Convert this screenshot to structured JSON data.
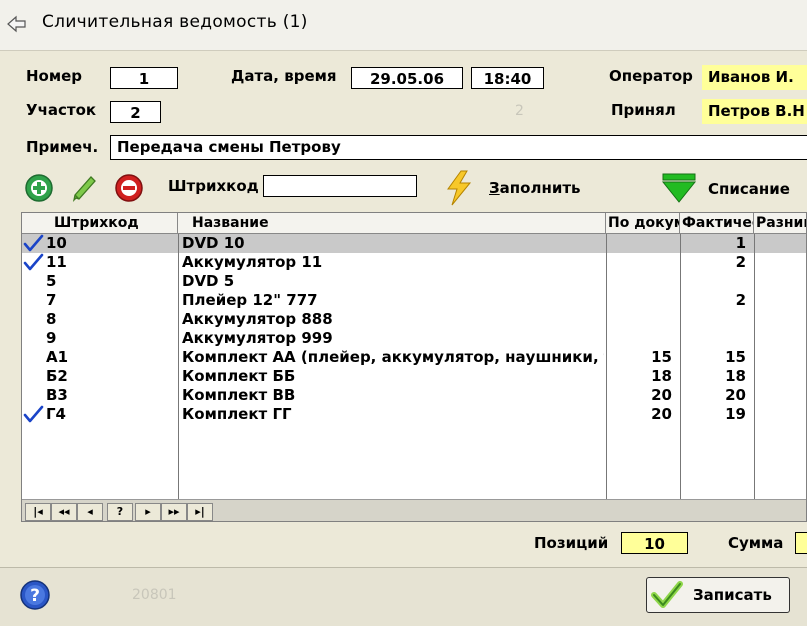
{
  "window": {
    "title": "Сличительная ведомость  (1)"
  },
  "header": {
    "number_label": "Номер",
    "number_value": "1",
    "datetime_label": "Дата, время",
    "date_value": "29.05.06",
    "time_value": "18:40",
    "operator_label": "Оператор",
    "operator_value": "Иванов И.",
    "section_label": "Участок",
    "section_value": "2",
    "ghost_value": "2",
    "accepted_label": "Принял",
    "accepted_value": "Петров В.Н",
    "note_label": "Примеч.",
    "note_value": "Передача смены Петрову"
  },
  "toolbar": {
    "barcode_label": "Штрихкод",
    "barcode_value": "",
    "fill_label_u": "З",
    "fill_label_rest": "аполнить",
    "writeoff_label": "Списание"
  },
  "table": {
    "columns": [
      "Штрихкод",
      "Название",
      "По докум",
      "Фактически",
      "Разница"
    ],
    "rows": [
      {
        "checked": true,
        "barcode": "10",
        "name": "DVD 10",
        "doc": "",
        "fact": "1"
      },
      {
        "checked": true,
        "barcode": "11",
        "name": "Аккумулятор 11",
        "doc": "",
        "fact": "2"
      },
      {
        "checked": false,
        "barcode": "5",
        "name": "DVD 5",
        "doc": "",
        "fact": ""
      },
      {
        "checked": false,
        "barcode": "7",
        "name": "Плейер 12\" 777",
        "doc": "",
        "fact": "2"
      },
      {
        "checked": false,
        "barcode": "8",
        "name": "Аккумулятор 888",
        "doc": "",
        "fact": ""
      },
      {
        "checked": false,
        "barcode": "9",
        "name": "Аккумулятор 999",
        "doc": "",
        "fact": ""
      },
      {
        "checked": false,
        "barcode": "А1",
        "name": "Комплект АА (плейер, аккумулятор, наушники, т",
        "doc": "15",
        "fact": "15"
      },
      {
        "checked": false,
        "barcode": "Б2",
        "name": "Комплект ББ",
        "doc": "18",
        "fact": "18"
      },
      {
        "checked": false,
        "barcode": "В3",
        "name": "Комплект ВВ",
        "doc": "20",
        "fact": "20"
      },
      {
        "checked": true,
        "barcode": "Г4",
        "name": "Комплект ГГ",
        "doc": "20",
        "fact": "19"
      }
    ],
    "selected_row": 0,
    "nav": [
      "|◂",
      "◂◂",
      "◂",
      "?",
      "▸",
      "▸▸",
      "▸|"
    ]
  },
  "footer": {
    "positions_label": "Позиций",
    "positions_value": "10",
    "sum_label": "Сумма",
    "sum_value": "",
    "code_text": "20801",
    "save_label": "Записать"
  },
  "colors": {
    "window_bg": "#ece9d8",
    "field_yellow": "#ffff99",
    "selected_row": "#c9c9c9",
    "check_blue": "#1a44c8",
    "add_green": "#2fa24a",
    "delete_red": "#d02020",
    "arrow_green": "#22bb22"
  }
}
